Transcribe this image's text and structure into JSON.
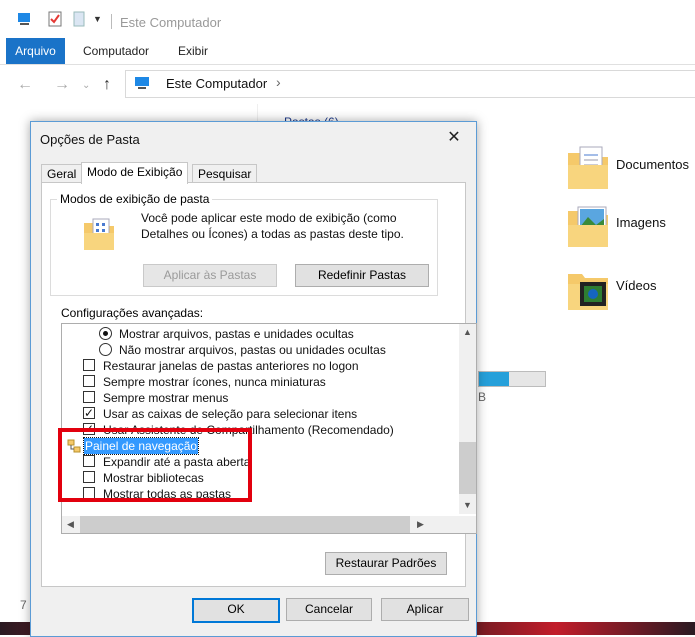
{
  "explorer": {
    "title": "Este Computador",
    "ribbon_tabs": [
      "Arquivo",
      "Computador",
      "Exibir"
    ],
    "address": "Este Computador",
    "folders_header": "Pastas (6)",
    "folders": [
      {
        "label": "Documentos",
        "icon": "documents-folder-icon"
      },
      {
        "label": "Imagens",
        "icon": "pictures-folder-icon"
      },
      {
        "label": "Vídeos",
        "icon": "videos-folder-icon"
      }
    ],
    "drive_fraction": 0.45,
    "drive_partial_text": "B",
    "left_partial_text": "7"
  },
  "dialog": {
    "title": "Opções de Pasta",
    "tabs": [
      "Geral",
      "Modo de Exibição",
      "Pesquisar"
    ],
    "group_title": "Modos de exibição de pasta",
    "group_text": "Você pode aplicar este modo de exibição (como Detalhes ou Ícones) a todas as pastas deste tipo.",
    "apply_folders_label": "Aplicar às Pastas",
    "reset_folders_label": "Redefinir Pastas",
    "advanced_title": "Configurações avançadas:",
    "advanced_items": [
      {
        "type": "radio",
        "checked": true,
        "label": "Mostrar arquivos, pastas e unidades ocultas"
      },
      {
        "type": "radio",
        "checked": false,
        "label": "Não mostrar arquivos, pastas ou unidades ocultas"
      },
      {
        "type": "checkbox",
        "checked": false,
        "label": "Restaurar janelas de pastas anteriores no logon"
      },
      {
        "type": "checkbox",
        "checked": false,
        "label": "Sempre mostrar ícones, nunca miniaturas"
      },
      {
        "type": "checkbox",
        "checked": false,
        "label": "Sempre mostrar menus"
      },
      {
        "type": "checkbox",
        "checked": true,
        "label": "Usar as caixas de seleção para selecionar itens"
      },
      {
        "type": "checkbox",
        "checked": true,
        "label": "Usar Assistente de Compartilhamento (Recomendado)"
      },
      {
        "type": "node",
        "label": "Painel de navegação"
      },
      {
        "type": "checkbox",
        "checked": false,
        "label": "Expandir até a pasta aberta"
      },
      {
        "type": "checkbox",
        "checked": false,
        "label": "Mostrar bibliotecas"
      },
      {
        "type": "checkbox",
        "checked": false,
        "label": "Mostrar todas as pastas"
      }
    ],
    "restore_defaults_label": "Restaurar Padrões",
    "ok_label": "OK",
    "cancel_label": "Cancelar",
    "apply_label": "Aplicar"
  },
  "colors": {
    "accent": "#1a73c8",
    "selection": "#3399ff",
    "annotation": "#e2000e"
  }
}
